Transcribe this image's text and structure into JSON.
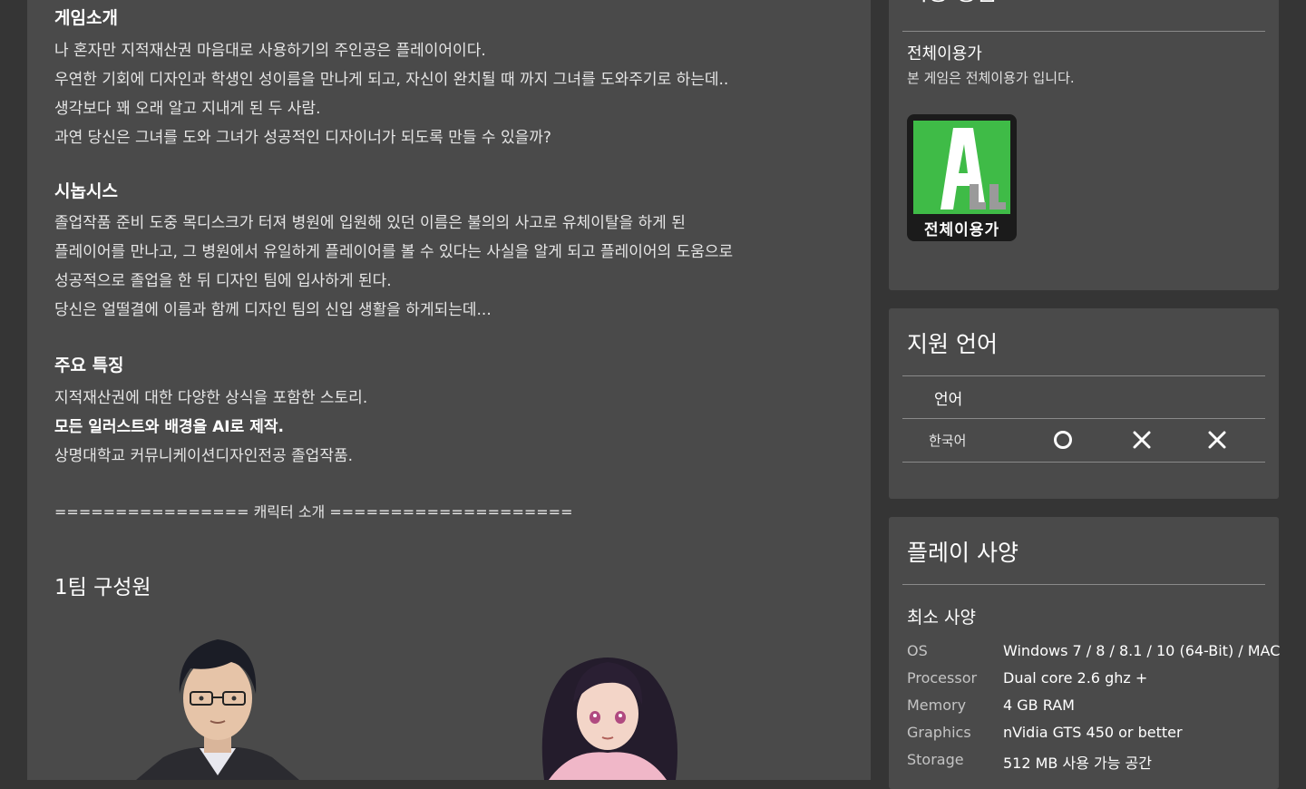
{
  "description": {
    "intro_heading": "게임소개",
    "intro_lines": [
      "나 혼자만 지적재산권 마음대로 사용하기의 주인공은 플레이어이다.",
      "우연한 기회에 디자인과 학생인 성이름을 만나게 되고, 자신이 완치될 때 까지 그녀를 도와주기로 하는데..",
      "생각보다 꽤 오래 알고 지내게 된 두 사람.",
      "과연 당신은 그녀를 도와 그녀가 성공적인 디자이너가 되도록 만들 수 있을까?"
    ],
    "synopsis_heading": "시놉시스",
    "synopsis_lines": [
      "졸업작품 준비 도중 목디스크가 터져 병원에 입원해 있던 이름은 불의의 사고로 유체이탈을 하게 된",
      "플레이어를 만나고, 그 병원에서 유일하게 플레이어를 볼 수 있다는 사실을 알게 되고 플레이어의 도움으로",
      "성공적으로 졸업을 한 뒤 디자인 팀에 입사하게 된다.",
      "당신은 얼떨결에 이름과 함께 디자인 팀의 신입 생활을 하게되는데..."
    ],
    "features_heading": "주요 특징",
    "features_lines": [
      "지적재산권에 대한 다양한 상식을 포함한 스토리.",
      "모든 일러스트와 배경을 AI로 제작.",
      "상명대학교 커뮤니케이션디자인전공 졸업작품."
    ],
    "character_divider": "================ 캐릭터 소개 ====================",
    "team_title": "1팀 구성원"
  },
  "rating_panel": {
    "title": "이용 등급",
    "rating_name": "전체이용가",
    "rating_desc": "본 게임은 전체이용가 입니다.",
    "badge_text": "전체이용가"
  },
  "language_panel": {
    "title": "지원 언어",
    "column_header": "언어",
    "languages": [
      {
        "name": "한국어",
        "interface": "O",
        "audio": "X",
        "subtitles": "X"
      }
    ]
  },
  "specs_panel": {
    "title": "플레이 사양",
    "subtitle": "최소 사양",
    "rows": [
      {
        "label": "OS",
        "value": "Windows 7 / 8 / 8.1 / 10 (64-Bit) / MAC"
      },
      {
        "label": "Processor",
        "value": "Dual core 2.6 ghz +"
      },
      {
        "label": "Memory",
        "value": "4 GB RAM"
      },
      {
        "label": "Graphics",
        "value": "nVidia GTS 450 or better"
      },
      {
        "label": "Storage",
        "value": "512 MB 사용 가능 공간"
      }
    ]
  },
  "colors": {
    "page_bg": "#353535",
    "panel_bg": "#4a4a4a",
    "rating_green": "#3fbb47"
  }
}
